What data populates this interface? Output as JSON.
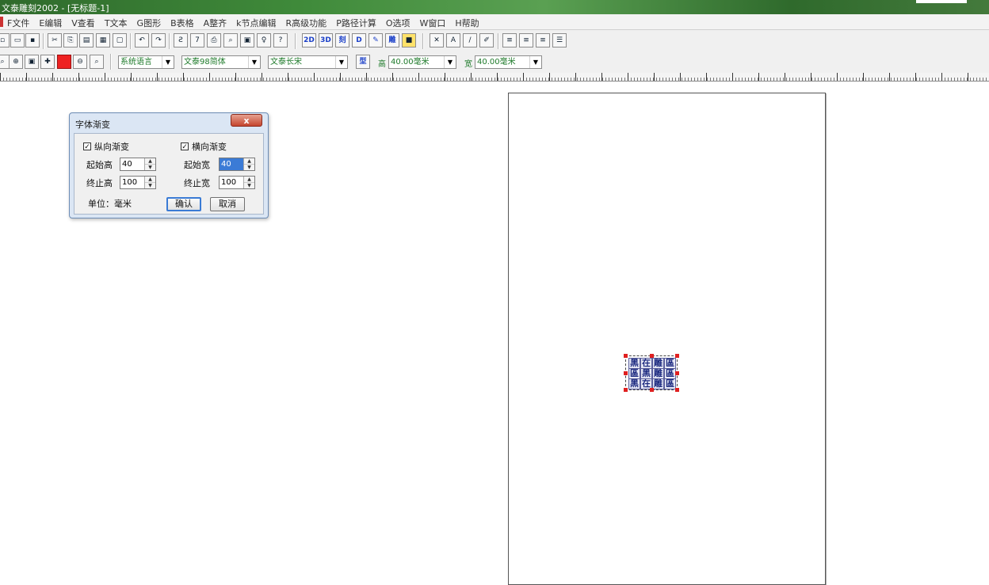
{
  "window": {
    "title": "文泰雕刻2002 - [无标题-1]"
  },
  "menu": [
    "F文件",
    "E编辑",
    "V查看",
    "T文本",
    "G图形",
    "B表格",
    "A整齐",
    "k节点编辑",
    "R高级功能",
    "P路径计算",
    "O选项",
    "W窗口",
    "H帮助"
  ],
  "toolbar1": {
    "buttons": [
      {
        "name": "open-icon",
        "glyph": "▭"
      },
      {
        "name": "save-icon",
        "glyph": "▪"
      },
      {
        "name": "cut-icon",
        "glyph": "✂"
      },
      {
        "name": "copy-icon",
        "glyph": "⎘"
      },
      {
        "name": "paste-icon",
        "glyph": "▤"
      },
      {
        "name": "undo-icon",
        "glyph": "↶"
      },
      {
        "name": "redo-icon",
        "glyph": "↷"
      },
      {
        "name": "print-icon",
        "glyph": "⎙"
      },
      {
        "name": "help-icon",
        "glyph": "?"
      },
      {
        "name": "2d-button",
        "glyph": "2D"
      },
      {
        "name": "3d-button",
        "glyph": "3D"
      },
      {
        "name": "engrave-button",
        "glyph": "雕"
      }
    ]
  },
  "toolbar2": {
    "language": "系统语言",
    "font": "文泰98简体",
    "font_style": "文泰长宋",
    "type_glyph": "型",
    "height_label": "高",
    "height_value": "40.00毫米",
    "width_label": "宽",
    "width_value": "40.00毫米"
  },
  "dialog": {
    "title": "字体渐变",
    "close": "x",
    "vertical": {
      "label": "纵向渐变",
      "checked": true
    },
    "horizontal": {
      "label": "横向渐变",
      "checked": true
    },
    "start_height_label": "起始高",
    "start_height_value": "40",
    "end_height_label": "终止高",
    "end_height_value": "100",
    "start_width_label": "起始宽",
    "start_width_value": "40",
    "end_width_label": "终止宽",
    "end_width_value": "100",
    "unit_label": "单位：毫米",
    "ok_label": "确认",
    "cancel_label": "取消",
    "check_mark": "✓"
  },
  "canvas": {
    "text_rows": [
      [
        "黑",
        "在",
        "雕",
        "區"
      ],
      [
        "區",
        "黑",
        "雕",
        "區"
      ],
      [
        "黑",
        "在",
        "雕",
        "區"
      ]
    ]
  }
}
